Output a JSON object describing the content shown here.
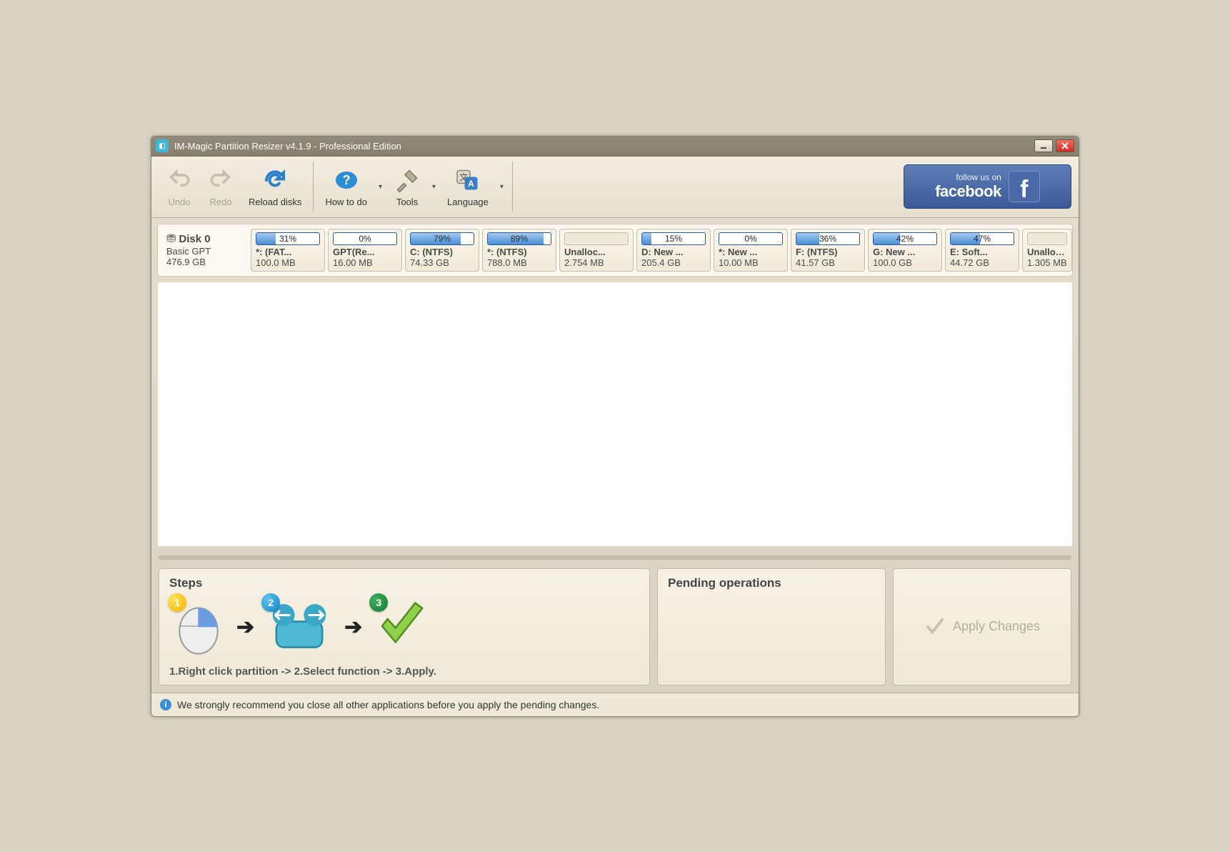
{
  "title": "IM-Magic Partition Resizer v4.1.9 - Professional Edition",
  "toolbar": {
    "undo": "Undo",
    "redo": "Redo",
    "reload": "Reload disks",
    "howto": "How to do",
    "tools": "Tools",
    "language": "Language"
  },
  "fb": {
    "line1": "follow us on",
    "line2": "facebook"
  },
  "disk": {
    "name": "Disk 0",
    "type": "Basic GPT",
    "size": "476.9 GB"
  },
  "partitions": [
    {
      "pct": "31%",
      "fill": 31,
      "name": "*: (FAT...",
      "size": "100.0 MB",
      "bar": true
    },
    {
      "pct": "0%",
      "fill": 0,
      "name": "GPT(Re...",
      "size": "16.00 MB",
      "bar": true
    },
    {
      "pct": "79%",
      "fill": 79,
      "name": "C: (NTFS)",
      "size": "74.33 GB",
      "bar": true
    },
    {
      "pct": "89%",
      "fill": 89,
      "name": "*: (NTFS)",
      "size": "788.0 MB",
      "bar": true
    },
    {
      "pct": "",
      "fill": 0,
      "name": "Unalloc...",
      "size": "2.754 MB",
      "bar": false
    },
    {
      "pct": "15%",
      "fill": 15,
      "name": "D: New ...",
      "size": "205.4 GB",
      "bar": true
    },
    {
      "pct": "0%",
      "fill": 0,
      "name": "*: New ...",
      "size": "10.00 MB",
      "bar": true
    },
    {
      "pct": "36%",
      "fill": 36,
      "name": "F: (NTFS)",
      "size": "41.57 GB",
      "bar": true
    },
    {
      "pct": "42%",
      "fill": 42,
      "name": "G: New ...",
      "size": "100.0 GB",
      "bar": true
    },
    {
      "pct": "47%",
      "fill": 47,
      "name": "E: Soft...",
      "size": "44.72 GB",
      "bar": true
    },
    {
      "pct": "",
      "fill": 0,
      "name": "Unalloc...",
      "size": "1.305 MB",
      "bar": false
    }
  ],
  "panels": {
    "steps_title": "Steps",
    "steps_caption": "1.Right click partition -> 2.Select function -> 3.Apply.",
    "pending_title": "Pending operations",
    "apply_label": "Apply Changes"
  },
  "status": "We strongly recommend you close all other applications before you apply the pending changes."
}
